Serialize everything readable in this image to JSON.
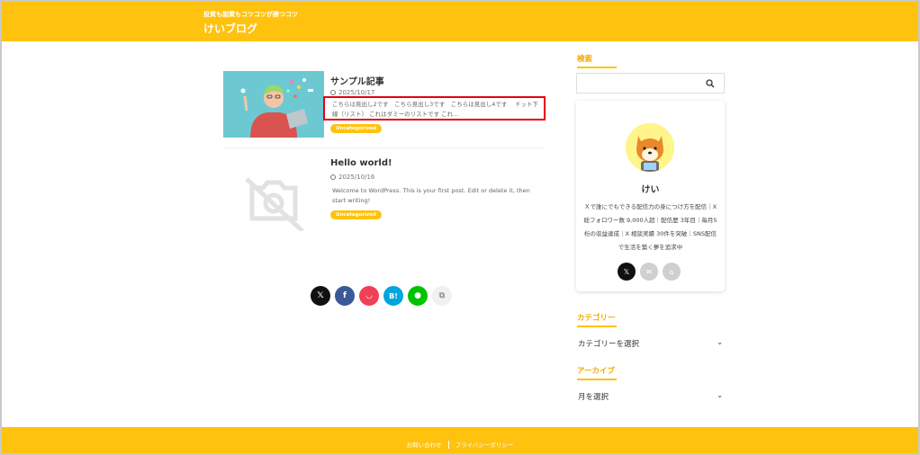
{
  "header": {
    "tagline": "投資も副業もコツコツが勝つコツ",
    "site_title": "けいブログ"
  },
  "posts": [
    {
      "title": "サンプル記事",
      "date": "2025/10/17",
      "excerpt": "こちらは見出し2です　こちら見出し3です　こちらは見出し4です　 ドット下線（リスト） これはダミーのリストです これ...",
      "category": "Uncategorized",
      "thumbnail": "person-with-laptop-illustration"
    },
    {
      "title": "Hello world!",
      "date": "2025/10/16",
      "excerpt": "Welcome to WordPress. This is your first post. Edit or delete it, then start writing!",
      "category": "Uncategorized",
      "thumbnail": "no-image-icon"
    }
  ],
  "share": {
    "buttons": [
      {
        "name": "x",
        "label": "𝕏",
        "color": "#111111"
      },
      {
        "name": "facebook",
        "label": "f",
        "color": "#3b5998"
      },
      {
        "name": "pocket",
        "label": "◡",
        "color": "#ef4056"
      },
      {
        "name": "hatena",
        "label": "B!",
        "color": "#00a4de"
      },
      {
        "name": "line",
        "label": "●",
        "color": "#00c300"
      },
      {
        "name": "copy",
        "label": "⧉",
        "color": "#f0f0f0"
      }
    ]
  },
  "sidebar": {
    "search_heading": "検索",
    "search_placeholder": "",
    "profile": {
      "name": "けい",
      "bio": "Ｘで誰にでもできる配信力の身につけ方を配信｜X 総フォロワー数 9,000人超｜配信歴 3年目｜毎月5桁の収益達成｜X 相談実績 30件を突破｜SNS配信で生活を築く夢を追求中"
    },
    "category_heading": "カテゴリー",
    "category_select": "カテゴリーを選択",
    "archive_heading": "アーカイブ",
    "archive_select": "月を選択"
  },
  "footer": {
    "contact": "お問い合わせ",
    "privacy": "プライバシーポリシー"
  },
  "colors": {
    "brand": "#ffc20e",
    "highlight_border": "#e60012"
  }
}
